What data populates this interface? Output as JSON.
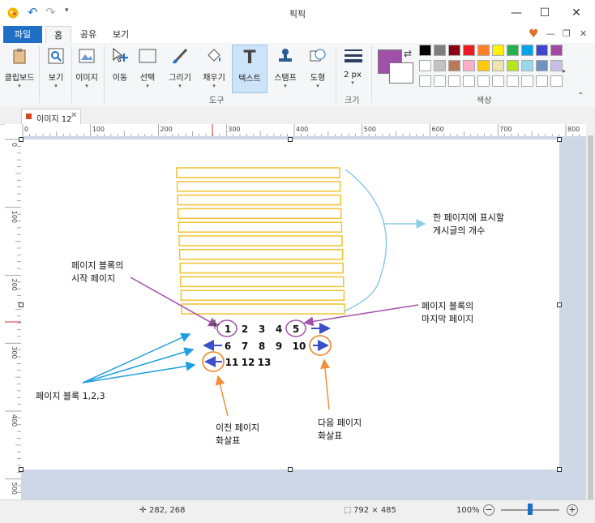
{
  "window": {
    "title": "픽픽"
  },
  "ribbon_tabs": [
    "파일",
    "홈",
    "공유",
    "보기"
  ],
  "tools": {
    "clipboard": "클립보드",
    "view": "보기",
    "image": "이미지",
    "move": "이동",
    "select": "선택",
    "draw": "그리기",
    "fill": "채우기",
    "text": "텍스트",
    "stamp": "스탬프",
    "shape": "도형",
    "size_value": "2 px"
  },
  "groups": {
    "tools": "도구",
    "size": "크기",
    "color": "색상"
  },
  "colors": {
    "primary": "#a050a8",
    "secondary": "#ffffff",
    "palette_row1": [
      "#000000",
      "#7f7f7f",
      "#880015",
      "#ed1c24",
      "#ff7f27",
      "#fff200",
      "#22b14c",
      "#00a2e8",
      "#3f48cc",
      "#a349a4"
    ],
    "palette_row2": [
      "#ffffff",
      "#c3c3c3",
      "#b97a57",
      "#ffaec9",
      "#ffc90e",
      "#efe4b0",
      "#b5e61d",
      "#99d9ea",
      "#7092be",
      "#c8bfe7"
    ]
  },
  "document_tab": {
    "label": "이미지 12"
  },
  "ruler_h": [
    "0",
    "100",
    "200",
    "300",
    "400",
    "500",
    "600",
    "700",
    "800"
  ],
  "ruler_v": [
    "0",
    "100",
    "200",
    "300",
    "400",
    "500"
  ],
  "annotation": {
    "rows_label_line1": "한 페이지에 표시할",
    "rows_label_line2": "게시글의 개수",
    "block_start_line1": "페이지 블록의",
    "block_start_line2": "시작 페이지",
    "block_end_line1": "페이지 블록의",
    "block_end_line2": "마지막 페이지",
    "page_blocks": "페이지 블록 1,2,3",
    "prev_line1": "이전 페이지",
    "prev_line2": "화살표",
    "next_line1": "다음 페이지",
    "next_line2": "화살표",
    "row1": [
      "1",
      "2",
      "3",
      "4",
      "5"
    ],
    "row2": [
      "6",
      "7",
      "8",
      "9",
      "10"
    ],
    "row3": [
      "11",
      "12",
      "13"
    ],
    "post_rows": 11
  },
  "status": {
    "cursor": "282, 268",
    "size": "792 × 485",
    "zoom": "100%"
  }
}
